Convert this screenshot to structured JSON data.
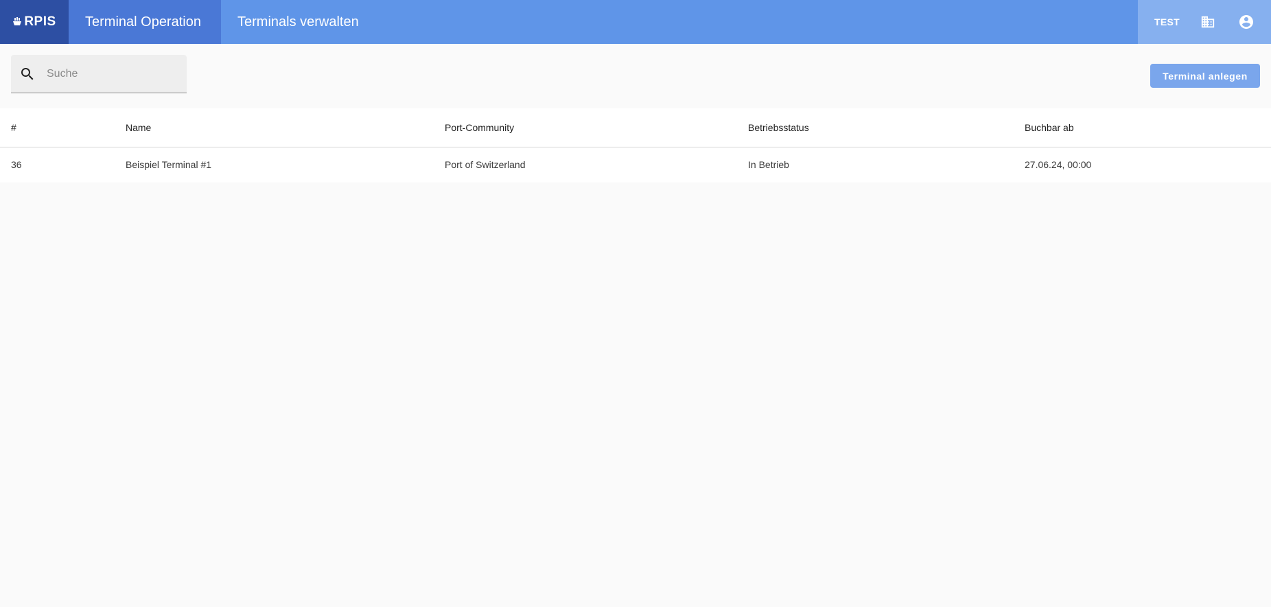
{
  "app": {
    "logo_text": "RPIS"
  },
  "header": {
    "tabs": [
      {
        "label": "Terminal Operation",
        "active": true
      },
      {
        "label": "Terminals verwalten",
        "active": false
      }
    ],
    "environment_label": "TEST",
    "icons": [
      "building-icon",
      "account-circle-icon"
    ]
  },
  "toolbar": {
    "search": {
      "placeholder": "Suche",
      "value": ""
    },
    "create_button_label": "Terminal anlegen"
  },
  "table": {
    "columns": [
      "#",
      "Name",
      "Port-Community",
      "Betriebsstatus",
      "Buchbar ab"
    ],
    "rows": [
      [
        "36",
        "Beispiel Terminal #1",
        "Port of Switzerland",
        "In Betrieb",
        "27.06.24, 00:00"
      ]
    ]
  },
  "colors": {
    "topbar": "#5f95e8",
    "logo_bg": "#2d4fa3",
    "active_tab": "#4a78d6",
    "right_group": "#86b0ef",
    "primary_button": "#7aa6ec",
    "page_bg": "#fafafa"
  }
}
